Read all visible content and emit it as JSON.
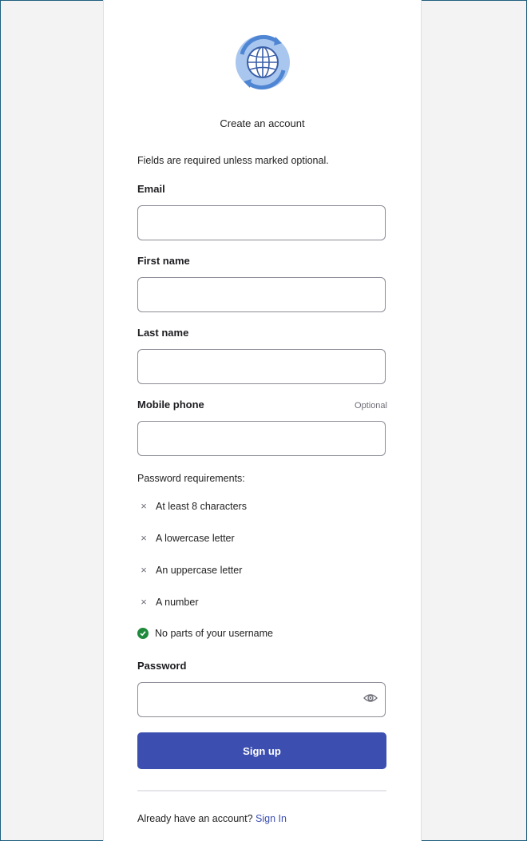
{
  "header": {
    "logo": "globe-refresh-logo",
    "title": "Create an account"
  },
  "form": {
    "required_note": "Fields are required unless marked optional.",
    "email": {
      "label": "Email",
      "value": "",
      "placeholder": ""
    },
    "first_name": {
      "label": "First name",
      "value": "",
      "placeholder": ""
    },
    "last_name": {
      "label": "Last name",
      "value": "",
      "placeholder": ""
    },
    "mobile_phone": {
      "label": "Mobile phone",
      "optional_label": "Optional",
      "value": "",
      "placeholder": ""
    },
    "password_requirements": {
      "heading": "Password requirements:",
      "items": [
        {
          "label": "At least 8 characters",
          "met": false
        },
        {
          "label": "A lowercase letter",
          "met": false
        },
        {
          "label": "An uppercase letter",
          "met": false
        },
        {
          "label": "A number",
          "met": false
        },
        {
          "label": "No parts of your username",
          "met": true
        }
      ]
    },
    "password": {
      "label": "Password",
      "value": "",
      "placeholder": "",
      "toggle_icon": "eye-icon"
    },
    "submit_label": "Sign up"
  },
  "footer": {
    "prompt": "Already have an account?",
    "link_label": "Sign In"
  },
  "colors": {
    "primary_button": "#3c4fb0",
    "link": "#3c4fb0",
    "success": "#1f8a3b",
    "logo_blue": "#5a8fd6"
  }
}
